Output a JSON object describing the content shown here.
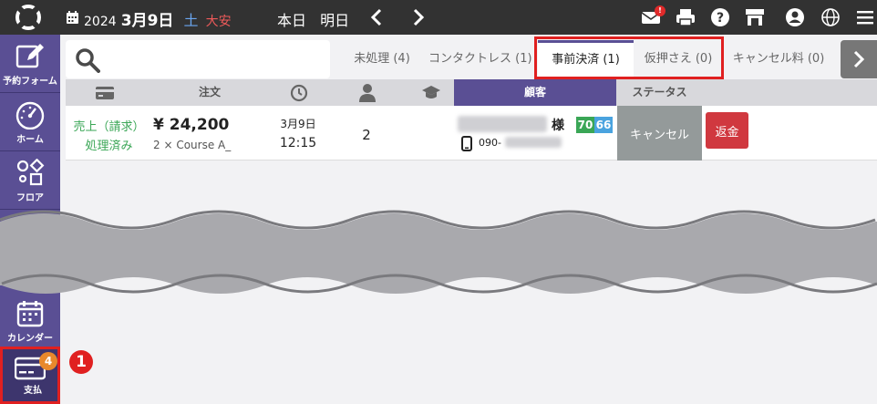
{
  "header": {
    "year": "2024",
    "month_day": "3月9日",
    "weekday": "土",
    "rokuyo": "大安",
    "today_label": "本日",
    "tomorrow_label": "明日",
    "mail_badge": "!"
  },
  "sidebar": {
    "items": [
      {
        "label": "予約フォーム"
      },
      {
        "label": "ホーム"
      },
      {
        "label": "フロア"
      },
      {
        "label": "カレンダー"
      },
      {
        "label": "支払",
        "badge": "4"
      }
    ]
  },
  "search": {
    "value": "",
    "placeholder": ""
  },
  "tabs": [
    {
      "label": "未処理 (4)"
    },
    {
      "label": "コンタクトレス (1)"
    },
    {
      "label": "事前決済 (1)",
      "active": true
    },
    {
      "label": "仮押さえ (0)"
    },
    {
      "label": "キャンセル料 (0)"
    }
  ],
  "table": {
    "headers": {
      "order": "注文",
      "customer": "顧客",
      "status": "ステータス"
    },
    "row": {
      "status_line1": "売上（請求）",
      "status_line2": "処理済み",
      "price": "¥ 24,200",
      "course": "2 × Course A_",
      "date": "3月9日",
      "time": "12:15",
      "people": "2",
      "customer_suffix": "様",
      "score1": "70",
      "score2": "66",
      "phone_prefix": "090-",
      "cancel_label": "キャンセル",
      "refund_label": "返金"
    }
  },
  "annotation": {
    "step": "1"
  },
  "colors": {
    "topbar": "#323232",
    "sidebar": "#5a4f94",
    "highlight": "#e02020",
    "score1": "#3aa656",
    "score2": "#4aa3df",
    "refund": "#d0383f",
    "cancel": "#949a9a"
  }
}
